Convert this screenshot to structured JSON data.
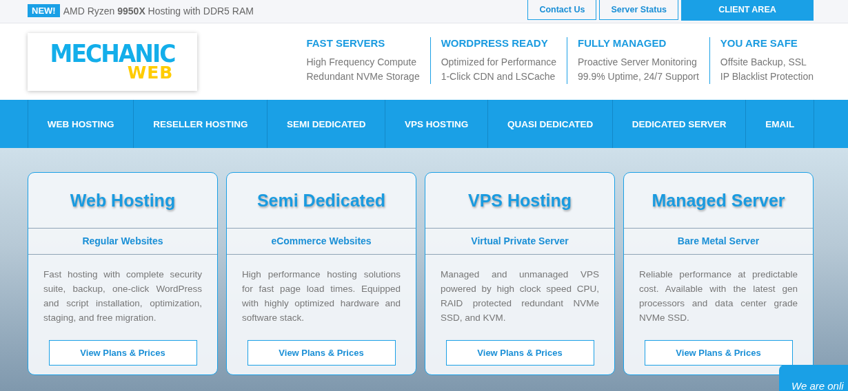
{
  "top_bar": {
    "badge": "NEW!",
    "announcement": "AMD Ryzen **9950X** Hosting with DDR5 RAM",
    "links": [
      {
        "label": "Contact Us",
        "kind": "outline"
      },
      {
        "label": "Server Status",
        "kind": "outline"
      },
      {
        "label": "CLIENT AREA",
        "kind": "solid"
      }
    ]
  },
  "logo": {
    "line_1": "MECHANIC",
    "line_2": "WEB"
  },
  "features": [
    {
      "title": "FAST SERVERS",
      "lines": [
        "High Frequency Compute",
        "Redundant NVMe Storage"
      ]
    },
    {
      "title": "WORDPRESS READY",
      "lines": [
        "Optimized for Performance",
        "1-Click CDN and LSCache"
      ]
    },
    {
      "title": "FULLY MANAGED",
      "lines": [
        "Proactive Server Monitoring",
        "99.9% Uptime, 24/7 Support"
      ]
    },
    {
      "title": "YOU ARE SAFE",
      "lines": [
        "Offsite Backup, SSL",
        "IP Blacklist Protection"
      ]
    }
  ],
  "nav": {
    "items": [
      "WEB HOSTING",
      "RESELLER HOSTING",
      "SEMI DEDICATED",
      "VPS HOSTING",
      "QUASI DEDICATED",
      "DEDICATED SERVER",
      "EMAIL"
    ]
  },
  "cards": [
    {
      "title": "Web Hosting",
      "subtitle": "Regular Websites",
      "text": "Fast hosting with complete security suite, backup, one-click WordPress and script installation, optimization, staging, and free migration.",
      "button": "View Plans & Prices"
    },
    {
      "title": "Semi Dedicated",
      "subtitle": "eCommerce Websites",
      "text": "High performance hosting solutions for fast page load times. Equipped with highly optimized hardware and software stack.",
      "button": "View Plans & Prices"
    },
    {
      "title": "VPS Hosting",
      "subtitle": "Virtual Private Server",
      "text": "Managed and unmanaged VPS powered by high clock speed CPU, RAID protected redundant NVMe SSD, and KVM.",
      "button": "View Plans & Prices"
    },
    {
      "title": "Managed Server",
      "subtitle": "Bare Metal Server",
      "text": "Reliable performance at predictable cost. Available with the latest gen processors and data center grade NVMe SSD.",
      "button": "View Plans & Prices"
    }
  ],
  "chat_widget": {
    "text": "We are onli"
  }
}
